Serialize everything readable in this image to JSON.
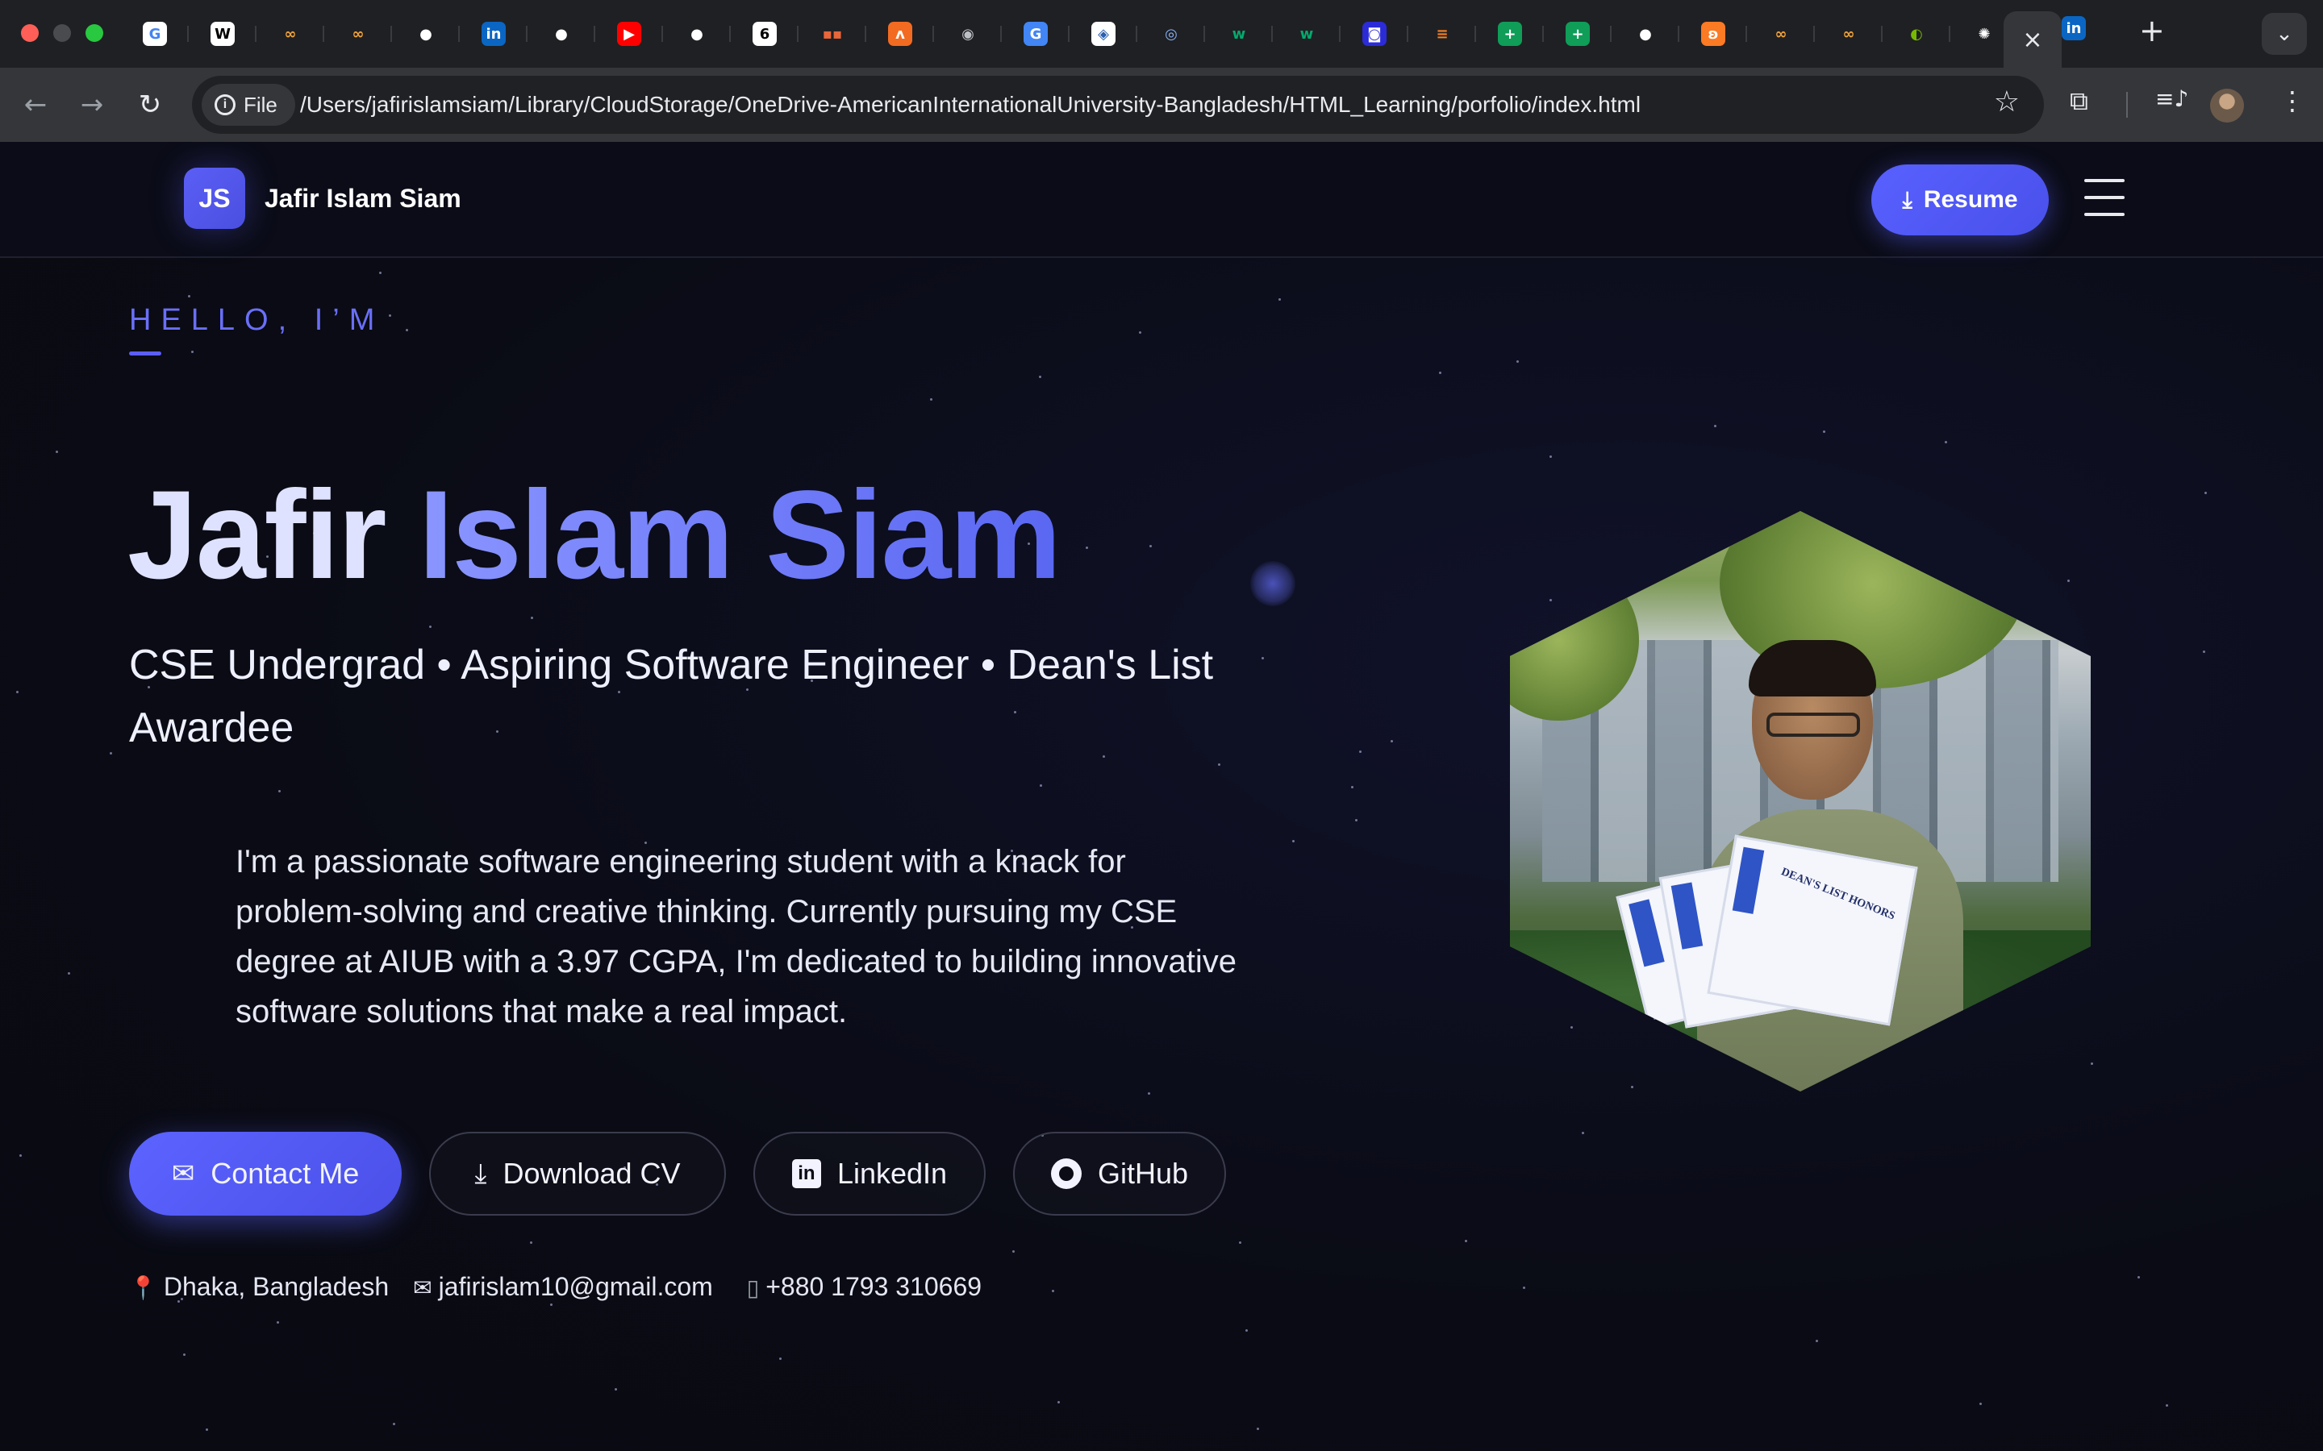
{
  "browser": {
    "url": "/Users/jafirislamsiam/Library/CloudStorage/OneDrive-AmericanInternationalUniversity-Bangladesh/HTML_Learning/porfolio/index.html",
    "file_chip_label": "File",
    "active_tab_close": "×",
    "new_tab": "+",
    "tab_menu": "⌄",
    "tabs": [
      {
        "icon": "google-icon",
        "glyph": "G",
        "color": "#ffffff",
        "fg": "#4285f4"
      },
      {
        "icon": "wikipedia-icon",
        "glyph": "W",
        "color": "#ffffff",
        "fg": "#000000"
      },
      {
        "icon": "infinity-icon",
        "glyph": "∞",
        "color": "#1f2023",
        "fg": "#f2a33a"
      },
      {
        "icon": "infinity-icon",
        "glyph": "∞",
        "color": "#1f2023",
        "fg": "#f2a33a"
      },
      {
        "icon": "github-icon",
        "glyph": "●",
        "color": "#1f2023",
        "fg": "#ffffff"
      },
      {
        "icon": "linkedin-icon",
        "glyph": "in",
        "color": "#0a66c2",
        "fg": "#ffffff"
      },
      {
        "icon": "github-icon",
        "glyph": "●",
        "color": "#1f2023",
        "fg": "#ffffff"
      },
      {
        "icon": "youtube-icon",
        "glyph": "▶",
        "color": "#ff0000",
        "fg": "#ffffff"
      },
      {
        "icon": "github-icon",
        "glyph": "●",
        "color": "#1f2023",
        "fg": "#ffffff"
      },
      {
        "icon": "circle-logo-icon",
        "glyph": "6",
        "color": "#ffffff",
        "fg": "#000000"
      },
      {
        "icon": "dots-icon",
        "glyph": "▪▪",
        "color": "#1f2023",
        "fg": "#e8663a"
      },
      {
        "icon": "zigzag-icon",
        "glyph": "ʌ",
        "color": "#f26b21",
        "fg": "#ffffff"
      },
      {
        "icon": "globe-icon",
        "glyph": "◉",
        "color": "#1f2023",
        "fg": "#bdc1c6"
      },
      {
        "icon": "translate-icon",
        "glyph": "G",
        "color": "#4285f4",
        "fg": "#ffffff"
      },
      {
        "icon": "shield-icon",
        "glyph": "◈",
        "color": "#ffffff",
        "fg": "#2a5fb0"
      },
      {
        "icon": "spiral-icon",
        "glyph": "◎",
        "color": "#1f2023",
        "fg": "#8ab4f8"
      },
      {
        "icon": "w3schools-icon",
        "glyph": "w",
        "color": "#1f2023",
        "fg": "#04aa6d"
      },
      {
        "icon": "w3schools-icon",
        "glyph": "w",
        "color": "#1f2023",
        "fg": "#04aa6d"
      },
      {
        "icon": "square-logo-icon",
        "glyph": "◙",
        "color": "#2b2bd8",
        "fg": "#ffffff"
      },
      {
        "icon": "stack-icon",
        "glyph": "≡",
        "color": "#1f2023",
        "fg": "#f48024"
      },
      {
        "icon": "sheets-icon",
        "glyph": "+",
        "color": "#0f9d58",
        "fg": "#ffffff"
      },
      {
        "icon": "sheets-icon",
        "glyph": "+",
        "color": "#0f9d58",
        "fg": "#ffffff"
      },
      {
        "icon": "github-icon",
        "glyph": "●",
        "color": "#1f2023",
        "fg": "#ffffff"
      },
      {
        "icon": "xampp-icon",
        "glyph": "ʚ",
        "color": "#fb7a24",
        "fg": "#ffffff"
      },
      {
        "icon": "infinity-icon",
        "glyph": "∞",
        "color": "#1f2023",
        "fg": "#f2a33a"
      },
      {
        "icon": "infinity-icon",
        "glyph": "∞",
        "color": "#1f2023",
        "fg": "#f2a33a"
      },
      {
        "icon": "nvidia-icon",
        "glyph": "◐",
        "color": "#1f2023",
        "fg": "#76b900"
      },
      {
        "icon": "chatgpt-icon",
        "glyph": "✺",
        "color": "#1f2023",
        "fg": "#ffffff"
      }
    ],
    "after_active_tab": {
      "icon": "linkedin-icon",
      "glyph": "in",
      "color": "#0a66c2",
      "fg": "#ffffff"
    }
  },
  "site": {
    "logo_initials": "JS",
    "logo_name": "Jafir Islam Siam",
    "resume_label": "Resume",
    "hello": "HELLO, I’M",
    "name_first": "Jafir",
    "name_rest": "Islam Siam",
    "tagline": "CSE Undergrad • Aspiring Software Engineer • Dean's List Awardee",
    "bio": "I'm a passionate software engineering student with a knack for problem-solving and creative thinking. Currently pursuing my CSE degree at AIUB with a 3.97 CGPA, I'm dedicated to building innovative software solutions that make a real impact.",
    "buttons": {
      "contact": "Contact Me",
      "download_cv": "Download CV",
      "linkedin": "LinkedIn",
      "github": "GitHub"
    },
    "contacts": {
      "location": "Dhaka, Bangladesh",
      "email": "jafirislam10@gmail.com",
      "phone": "+880 1793 310669"
    },
    "cert_text": "DEAN'S LIST HONORS",
    "accent": "#5b5ef5"
  }
}
